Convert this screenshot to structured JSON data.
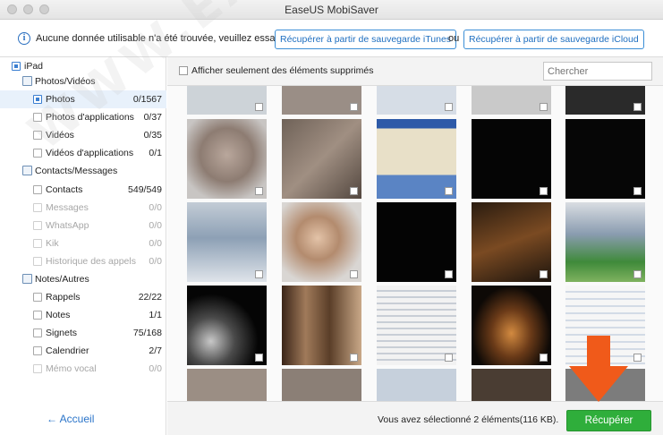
{
  "window": {
    "title": "EaseUS MobiSaver"
  },
  "info": {
    "message": "Aucune donnée utilisable n'a été trouvée, veuillez essayez",
    "itunes_button": "Récupérer à partir de sauvegarde iTunes",
    "separator": "ou",
    "icloud_button": "Récupérer à partir de sauvegarde iCloud"
  },
  "sidebar": {
    "device": "iPad",
    "groups": [
      {
        "label": "Photos/Vidéos",
        "icon": "photo-icon"
      },
      {
        "label": "Contacts/Messages",
        "icon": "contacts-icon"
      },
      {
        "label": "Notes/Autres",
        "icon": "notes-icon"
      }
    ],
    "items": [
      {
        "label": "Photos",
        "count": "0/1567"
      },
      {
        "label": "Photos d'applications",
        "count": "0/37"
      },
      {
        "label": "Vidéos",
        "count": "0/35"
      },
      {
        "label": "Vidéos d'applications",
        "count": "0/1"
      },
      {
        "label": "Contacts",
        "count": "549/549"
      },
      {
        "label": "Messages",
        "count": "0/0"
      },
      {
        "label": "WhatsApp",
        "count": "0/0"
      },
      {
        "label": "Kik",
        "count": "0/0"
      },
      {
        "label": "Historique des appels",
        "count": "0/0"
      },
      {
        "label": "Rappels",
        "count": "22/22"
      },
      {
        "label": "Notes",
        "count": "1/1"
      },
      {
        "label": "Signets",
        "count": "75/168"
      },
      {
        "label": "Calendrier",
        "count": "2/7"
      },
      {
        "label": "Mémo vocal",
        "count": "0/0"
      }
    ],
    "home_label": "Accueil",
    "home_arrow": "←"
  },
  "toolbar": {
    "show_deleted_label": "Afficher seulement des éléments supprimés",
    "search_placeholder": "Chercher"
  },
  "footer": {
    "status": "Vous avez sélectionné 2 éléments(116 KB).",
    "recover_button": "Récupérer"
  },
  "watermark": "WWW.EASEUS.COM",
  "colors": {
    "accent": "#2a74c9",
    "recover": "#2fae3b",
    "arrow": "#f05a1a"
  }
}
